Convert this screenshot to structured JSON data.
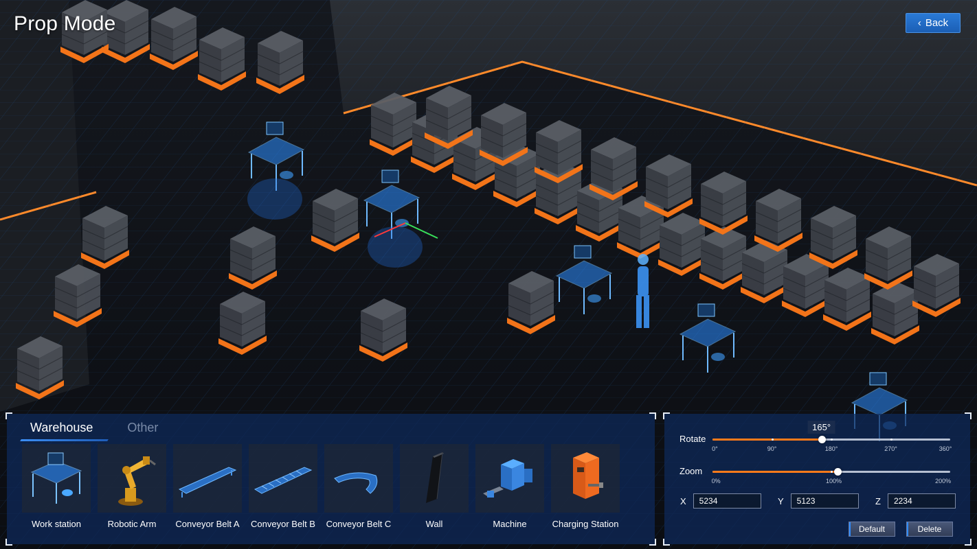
{
  "page": {
    "title": "Prop Mode",
    "back_label": "Back"
  },
  "tabs": [
    {
      "label": "Warehouse",
      "active": true
    },
    {
      "label": "Other",
      "active": false
    }
  ],
  "props": [
    {
      "label": "Work station",
      "icon": "workstation-icon"
    },
    {
      "label": "Robotic Arm",
      "icon": "robotic-arm-icon"
    },
    {
      "label": "Conveyor Belt A",
      "icon": "conveyor-belt-a-icon"
    },
    {
      "label": "Conveyor Belt B",
      "icon": "conveyor-belt-b-icon"
    },
    {
      "label": "Conveyor Belt C",
      "icon": "conveyor-belt-c-icon"
    },
    {
      "label": "Wall",
      "icon": "wall-icon"
    },
    {
      "label": "Machine",
      "icon": "machine-icon"
    },
    {
      "label": "Charging Station",
      "icon": "charging-station-icon"
    }
  ],
  "transform": {
    "rotate": {
      "label": "Rotate",
      "value": 165,
      "value_label": "165°",
      "min": 0,
      "max": 360,
      "ticks": [
        "0°",
        "90°",
        "180°",
        "270°",
        "360°"
      ]
    },
    "zoom": {
      "label": "Zoom",
      "value": 105,
      "min": 0,
      "max": 200,
      "ticks": [
        "0%",
        "100%",
        "200%"
      ]
    },
    "x": {
      "label": "X",
      "value": "5234"
    },
    "y": {
      "label": "Y",
      "value": "5123"
    },
    "z": {
      "label": "Z",
      "value": "2234"
    },
    "default_label": "Default",
    "delete_label": "Delete"
  },
  "colors": {
    "accent_blue": "#2a7ad6",
    "accent_orange": "#ff7a1a",
    "panel": "#0e2a5c"
  }
}
